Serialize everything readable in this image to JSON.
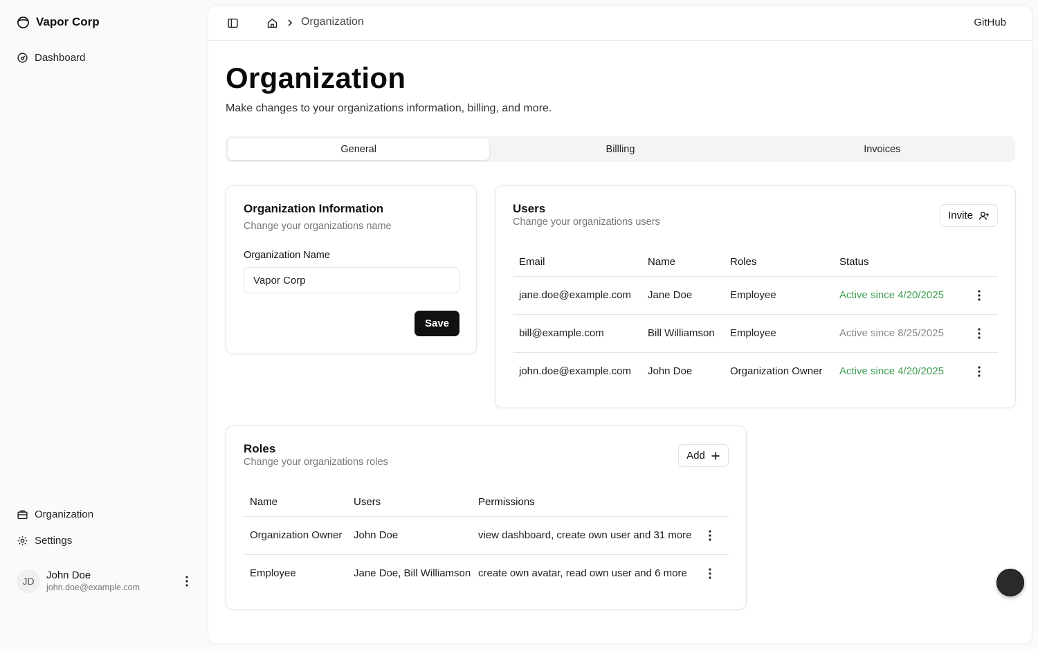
{
  "sidebar": {
    "brand": "Vapor Corp",
    "top_items": [
      {
        "label": "Dashboard",
        "icon": "dashboard-gauge-icon"
      }
    ],
    "bottom_items": [
      {
        "label": "Organization",
        "icon": "briefcase-icon"
      },
      {
        "label": "Settings",
        "icon": "gear-icon"
      }
    ],
    "user": {
      "initials": "JD",
      "name": "John Doe",
      "email": "john.doe@example.com"
    }
  },
  "topbar": {
    "breadcrumb": "Organization",
    "github": "GitHub"
  },
  "page": {
    "title": "Organization",
    "subtitle": "Make changes to your organizations information, billing, and more."
  },
  "tabs": [
    {
      "label": "General",
      "active": true
    },
    {
      "label": "Billling",
      "active": false
    },
    {
      "label": "Invoices",
      "active": false
    }
  ],
  "org_info": {
    "title": "Organization Information",
    "desc": "Change your organizations name",
    "field_label": "Organization Name",
    "field_value": "Vapor Corp",
    "save_label": "Save"
  },
  "users": {
    "title": "Users",
    "desc": "Change your organizations users",
    "invite_label": "Invite",
    "columns": [
      "Email",
      "Name",
      "Roles",
      "Status"
    ],
    "rows": [
      {
        "email": "jane.doe@example.com",
        "name": "Jane Doe",
        "role": "Employee",
        "status": "Active since 4/20/2025",
        "status_kind": "active"
      },
      {
        "email": "bill@example.com",
        "name": "Bill Williamson",
        "role": "Employee",
        "status": "Active since 8/25/2025",
        "status_kind": "muted"
      },
      {
        "email": "john.doe@example.com",
        "name": "John Doe",
        "role": "Organization Owner",
        "status": "Active since 4/20/2025",
        "status_kind": "active"
      }
    ]
  },
  "roles": {
    "title": "Roles",
    "desc": "Change your organizations roles",
    "add_label": "Add",
    "columns": [
      "Name",
      "Users",
      "Permissions"
    ],
    "rows": [
      {
        "name": "Organization Owner",
        "users": "John Doe",
        "permissions": "view dashboard, create own user and 31 more"
      },
      {
        "name": "Employee",
        "users": "Jane Doe, Bill Williamson",
        "permissions": "create own avatar, read own user and 6 more"
      }
    ]
  },
  "colors": {
    "accent_dark": "#111111",
    "status_active": "#3e9e52",
    "status_muted": "#888888"
  }
}
